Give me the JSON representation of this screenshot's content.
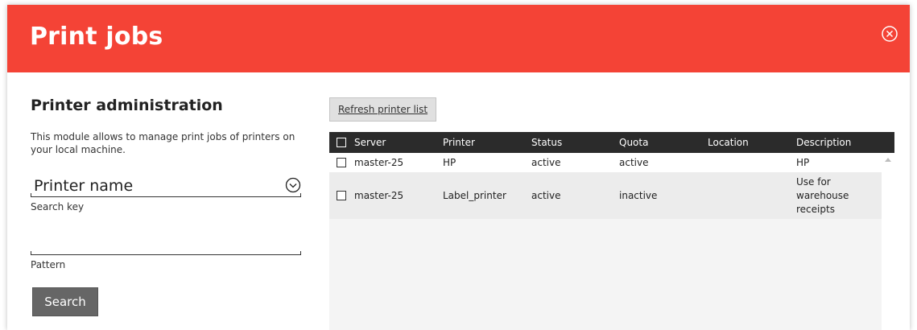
{
  "dialog": {
    "title": "Print jobs",
    "accent_color": "#f44336",
    "close_icon": "close-circle-icon"
  },
  "left": {
    "section_title": "Printer administration",
    "description": "This module allows to manage print jobs of printers on your local machine.",
    "search_key": {
      "value": "Printer name",
      "label": "Search key",
      "icon": "chevron-down-circle-icon"
    },
    "pattern": {
      "value": "",
      "label": "Pattern"
    },
    "search_button": "Search"
  },
  "right": {
    "refresh_button": "Refresh printer list",
    "table": {
      "columns": [
        "Server",
        "Printer",
        "Status",
        "Quota",
        "Location",
        "Description"
      ],
      "rows": [
        {
          "server": "master-25",
          "printer": "HP",
          "status": "active",
          "quota": "active",
          "location": "",
          "description": "HP"
        },
        {
          "server": "master-25",
          "printer": "Label_printer",
          "status": "active",
          "quota": "inactive",
          "location": "",
          "description": "Use for warehouse receipts"
        }
      ]
    }
  }
}
